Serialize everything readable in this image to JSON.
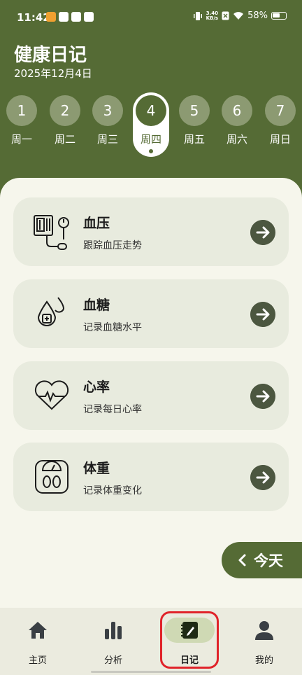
{
  "status_bar": {
    "time": "11:42",
    "speed_value": "3.40",
    "speed_unit": "KB/s",
    "battery": "58%"
  },
  "header": {
    "title": "健康日记",
    "date": "2025年12月4日"
  },
  "days": [
    {
      "num": "1",
      "label": "周一"
    },
    {
      "num": "2",
      "label": "周二"
    },
    {
      "num": "3",
      "label": "周三"
    },
    {
      "num": "4",
      "label": "周四"
    },
    {
      "num": "5",
      "label": "周五"
    },
    {
      "num": "6",
      "label": "周六"
    },
    {
      "num": "7",
      "label": "周日"
    }
  ],
  "active_day": "4",
  "cards": [
    {
      "title": "血压",
      "subtitle": "跟踪血压走势",
      "icon": "blood-pressure-monitor-icon"
    },
    {
      "title": "血糖",
      "subtitle": "记录血糖水平",
      "icon": "blood-drop-icon"
    },
    {
      "title": "心率",
      "subtitle": "记录每日心率",
      "icon": "heart-rate-icon"
    },
    {
      "title": "体重",
      "subtitle": "记录体重变化",
      "icon": "weight-scale-icon"
    }
  ],
  "today_button": "今天",
  "nav": [
    {
      "label": "主页",
      "icon": "home-icon"
    },
    {
      "label": "分析",
      "icon": "bar-chart-icon"
    },
    {
      "label": "日记",
      "icon": "diary-icon"
    },
    {
      "label": "我的",
      "icon": "user-icon"
    }
  ],
  "active_nav": "日记",
  "colors": {
    "primary": "#556b35",
    "card_bg": "#e8ebde",
    "content_bg": "#f6f6ec",
    "highlight": "#e0232a"
  }
}
